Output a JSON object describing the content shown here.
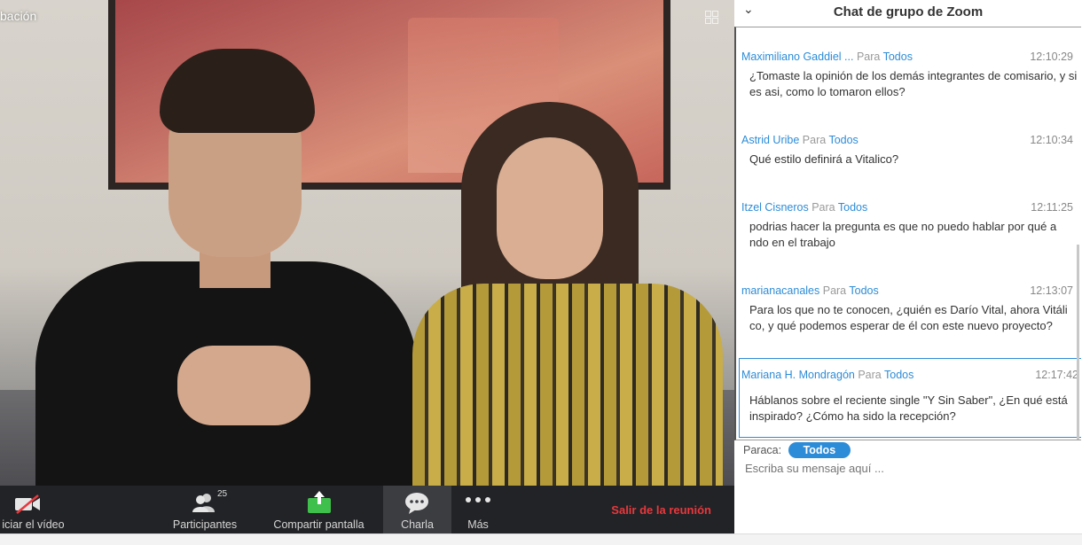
{
  "video": {
    "rec_label": "bación"
  },
  "toolbar": {
    "video_label": "iciar el vídeo",
    "participants_label": "Participantes",
    "participants_count": "25",
    "share_label": "Compartir pantalla",
    "chat_label": "Charla",
    "more_label": "Más",
    "leave_label": "Salir de la reunión"
  },
  "chat": {
    "title": "Chat de grupo de Zoom",
    "to_word": "Para",
    "messages": [
      {
        "sender": "Maximiliano Gaddiel ...",
        "to": "Todos",
        "time": "12:10:29",
        "text": "¿Tomaste la opinión de los demás integrantes de comisario, y si es asi, como lo tomaron ellos?"
      },
      {
        "sender": "Astrid Uribe",
        "to": "Todos",
        "time": "12:10:34",
        "text": "Qué estilo definirá a Vitalico?"
      },
      {
        "sender": "Itzel Cisneros",
        "to": "Todos",
        "time": "12:11:25",
        "text": "podrias hacer la pregunta es que no puedo hablar por qué a ndo en el trabajo"
      },
      {
        "sender": "marianacanales",
        "to": "Todos",
        "time": "12:13:07",
        "text": "Para los que no te conocen, ¿quién es Darío Vital, ahora Vitáli co, y qué podemos esperar de él con este nuevo proyecto?"
      },
      {
        "sender": "Mariana H. Mondragón",
        "to": "Todos",
        "time": "12:17:42",
        "text": "Háblanos sobre el reciente single \"Y Sin Saber\", ¿En qué está inspirado? ¿Cómo ha sido la recepción?"
      }
    ],
    "to_label": "Paraca:",
    "to_selected": "Todos",
    "input_placeholder": "Escriba su mensaje aquí ..."
  },
  "colors": {
    "accent": "#2d8cd7",
    "leave": "#e8383d",
    "toolbar_bg": "#222326"
  }
}
